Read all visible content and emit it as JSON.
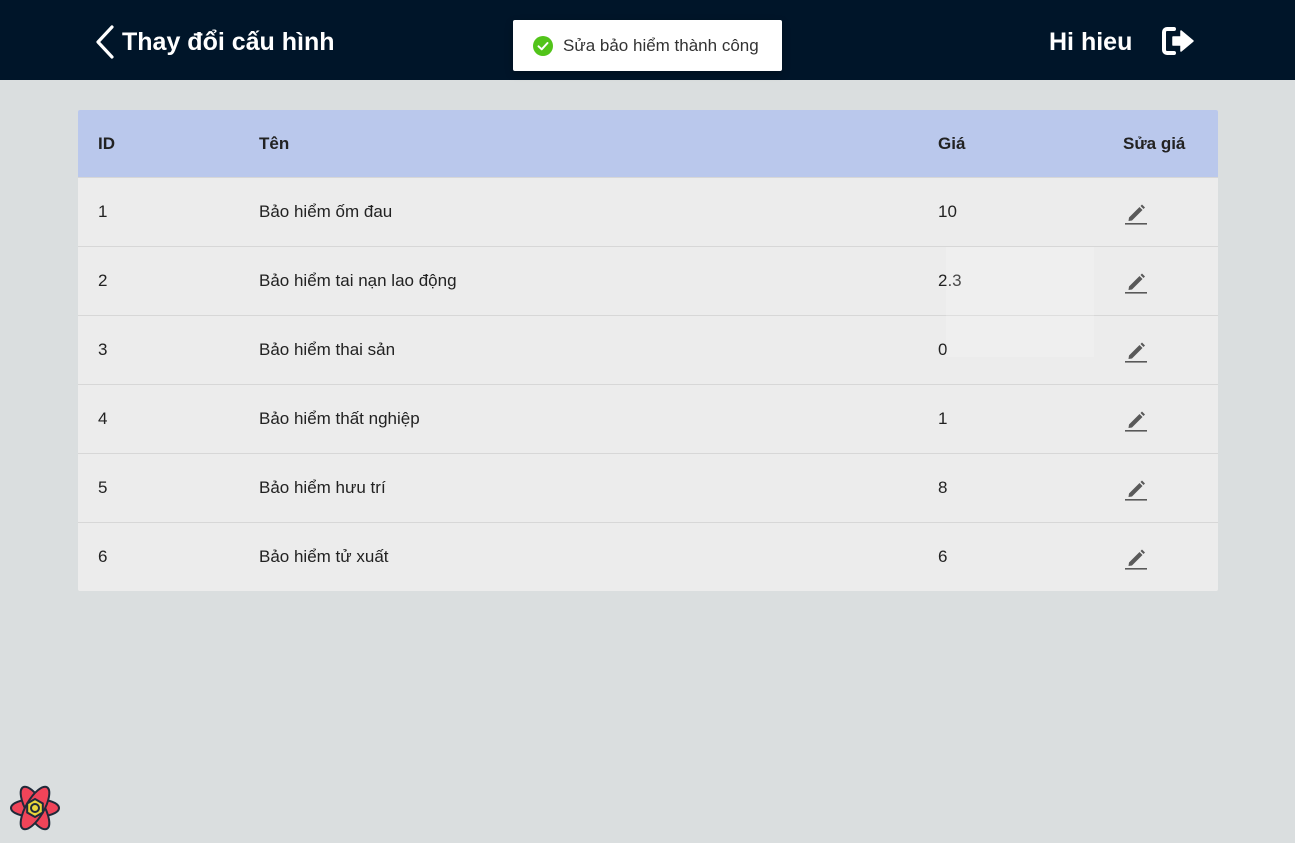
{
  "header": {
    "title": "Thay đổi cấu hình",
    "greeting": "Hi hieu",
    "background_color": "#001529"
  },
  "toast": {
    "message": "Sửa bảo hiểm thành công",
    "icon": "check-circle-icon",
    "icon_color": "#52c41a"
  },
  "table": {
    "header_color": "#bac8ec",
    "columns": {
      "id": "ID",
      "name": "Tên",
      "price": "Giá",
      "edit": "Sửa giá"
    },
    "rows": [
      {
        "id": "1",
        "name": "Bảo hiểm ốm đau",
        "price": "10"
      },
      {
        "id": "2",
        "name": "Bảo hiểm tai nạn lao động",
        "price": "2.3"
      },
      {
        "id": "3",
        "name": "Bảo hiểm thai sản",
        "price": "0"
      },
      {
        "id": "4",
        "name": "Bảo hiểm thất nghiệp",
        "price": "1"
      },
      {
        "id": "5",
        "name": "Bảo hiểm hưu trí",
        "price": "8"
      },
      {
        "id": "6",
        "name": "Bảo hiểm tử xuất",
        "price": "6"
      }
    ],
    "edit_icon": "pencil-icon"
  },
  "icons": {
    "back": "chevron-left-icon",
    "logout": "logout-icon",
    "devtools": "react-logo-icon"
  }
}
